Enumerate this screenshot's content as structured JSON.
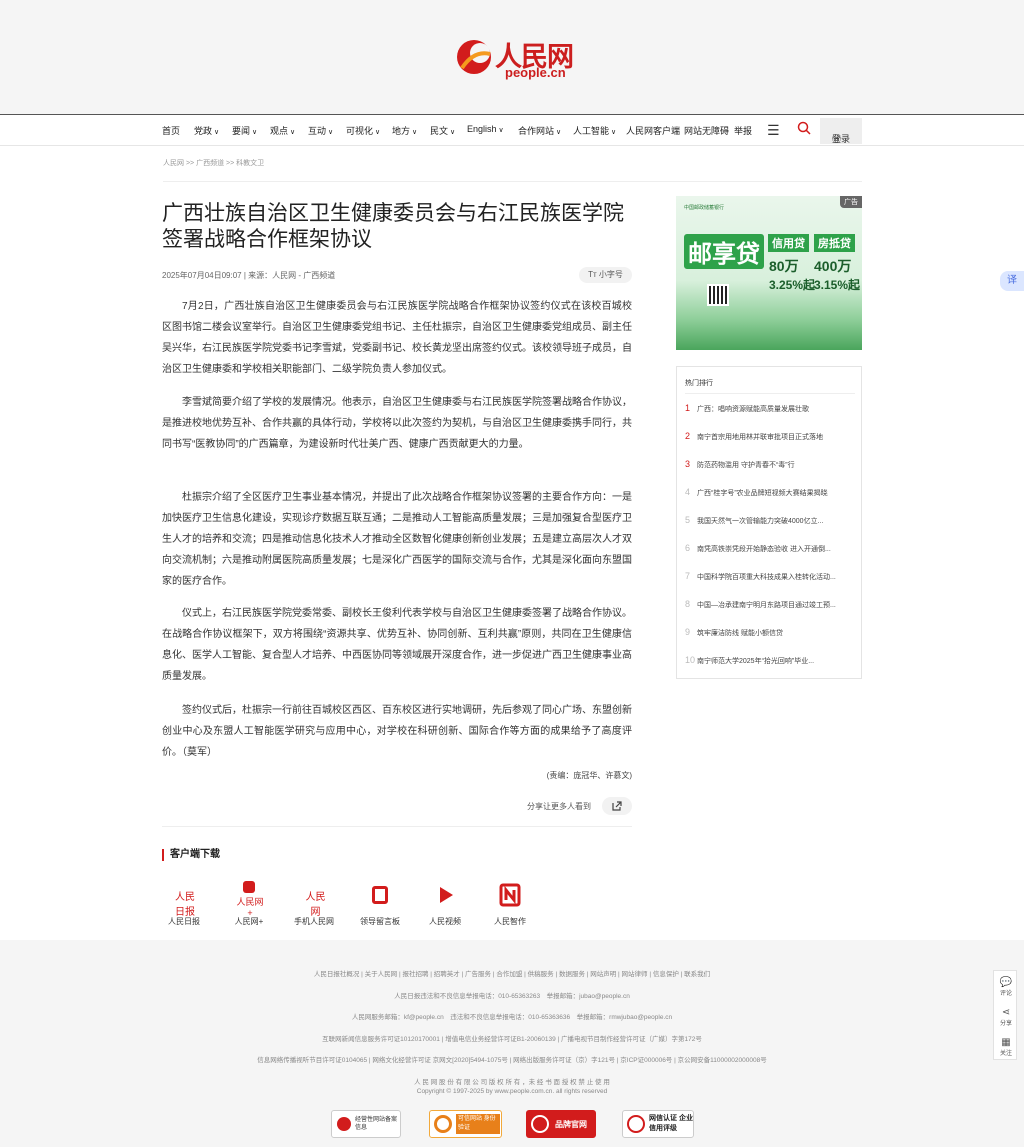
{
  "header": {
    "logo_text": "人民网",
    "logo_sub": "people.cn"
  },
  "nav": {
    "items": [
      "首页",
      "党政",
      "要闻",
      "观点",
      "互动",
      "可视化",
      "地方",
      "民文",
      "English",
      "合作网站",
      "人工智能",
      "人民网客户端",
      "网站无障碍",
      "举报"
    ],
    "login": "登录"
  },
  "breadcrumb": "人民网 >> 广西频道 >> 科教文卫",
  "article": {
    "title": "广西壮族自治区卫生健康委员会与右江民族医学院签署战略合作框架协议",
    "meta": "2025年07月04日09:07 | 来源：人民网 - 广西频道",
    "font_toggle": "小字号",
    "paragraphs": [
      "7月2日，广西壮族自治区卫生健康委员会与右江民族医学院战略合作框架协议签约仪式在该校百城校区图书馆二楼会议室举行。自治区卫生健康委党组书记、主任杜振宗，自治区卫生健康委党组成员、副主任吴兴华，右江民族医学院党委书记李雪斌，党委副书记、校长黄龙坚出席签约仪式。该校领导班子成员，自治区卫生健康委和学校相关职能部门、二级学院负责人参加仪式。",
      "李雪斌简要介绍了学校的发展情况。他表示，自治区卫生健康委与右江民族医学院签署战略合作协议，是推进校地优势互补、合作共赢的具体行动，学校将以此次签约为契机，与自治区卫生健康委携手同行，共同书写“医教协同”的广西篇章，为建设新时代壮美广西、健康广西贡献更大的力量。",
      "杜振宗介绍了全区医疗卫生事业基本情况，并提出了此次战略合作框架协议签署的主要合作方向：一是加快医疗卫生信息化建设，实现诊疗数据互联互通；二是推动人工智能高质量发展；三是加强复合型医疗卫生人才的培养和交流；四是推动信息化技术人才推动全区数智化健康创新创业发展；五是建立高层次人才双向交流机制；六是推动附属医院高质量发展；七是深化广西医学的国际交流与合作，尤其是深化面向东盟国家的医疗合作。",
      "仪式上，右江民族医学院党委常委、副校长王俊利代表学校与自治区卫生健康委签署了战略合作协议。在战略合作协议框架下，双方将围绕“资源共享、优势互补、协同创新、互利共赢”原则，共同在卫生健康信息化、医学人工智能、复合型人才培养、中西医协同等领域展开深度合作，进一步促进广西卫生健康事业高质量发展。",
      "签约仪式后，杜振宗一行前往百城校区西区、百东校区进行实地调研，先后参观了同心广场、东盟创新创业中心及东盟人工智能医学研究与应用中心，对学校在科研创新、国际合作等方面的成果给予了高度评价。（莫军）"
    ],
    "editor": "(责编：庞冠华、许慕文)",
    "share": "分享让更多人看到"
  },
  "ad": {
    "tag": "广告",
    "header": "中国邮政储蓄银行",
    "brand": "邮享贷",
    "tab1": "信用贷",
    "tab2": "房抵贷",
    "amount1": "80万",
    "amount2": "400万",
    "rate1": "3.25%起",
    "rate2": "3.15%起"
  },
  "hot": {
    "title": "热门排行",
    "items": [
      "广西：唱响资源赋能高质量发展壮歌",
      "南宁首宗用地用林并联审批项目正式落地",
      "防范药物滥用 守护青春不“毒”行",
      "广西“桂字号”农业品牌短视频大赛结果揭晓",
      "我国天然气一次管输能力突破4000亿立...",
      "南凭高铁崇凭段开始静态验收 进入开通倒...",
      "中国科学院百项重大科技成果入桂转化活动...",
      "中国—冶承建南宁明月东路项目通过竣工预...",
      "筑牢廉洁防线 赋能小额信贷",
      "南宁师范大学2025年“拾光回响”毕业..."
    ]
  },
  "apps": {
    "heading": "客户端下载",
    "items": [
      "人民日报",
      "人民网+",
      "手机人民网",
      "领导留言板",
      "人民视频",
      "人民智作"
    ]
  },
  "footer": {
    "line1": "人民日报社概况 | 关于人民网 | 报社招聘 | 招聘英才 | 广告服务 | 合作加盟 | 供稿服务 | 数据服务 | 网站声明 | 网站律师 | 信息保护 | 联系我们",
    "line2": "人民日报违法和不良信息举报电话：010-65363263　举报邮箱：jubao@people.cn",
    "line3": "人民网服务邮箱：kf@people.cn　违法和不良信息举报电话：010-65363636　举报邮箱：rmwjubao@people.cn",
    "line4": "互联网新闻信息服务许可证10120170001 | 增值电信业务经营许可证B1-20060139 | 广播电视节目制作经营许可证（广媒）字第172号",
    "line5": "信息网络传播视听节目许可证0104065 | 网络文化经营许可证 京网文[2020]5494-1075号 | 网络出版服务许可证（京）字121号 | 京ICP证000006号 | 京公网安备11000002000008号",
    "line6": "人 民 网 股 份 有 限 公 司 版 权 所 有 ，未 经 书 面 授 权 禁 止 使 用",
    "line7": "Copyright © 1997-2025 by www.people.com.cn. all rights reserved",
    "badges": [
      "经营性网站备案信息",
      "可信网站 身份验证",
      "品牌官网",
      "网信认证 企业信用评级"
    ]
  },
  "sidetools": [
    "评论",
    "分享",
    "关注"
  ],
  "translate_icon": "译",
  "colors": {
    "brand_red": "#d21c1c",
    "ad_green": "#2ea24a"
  }
}
